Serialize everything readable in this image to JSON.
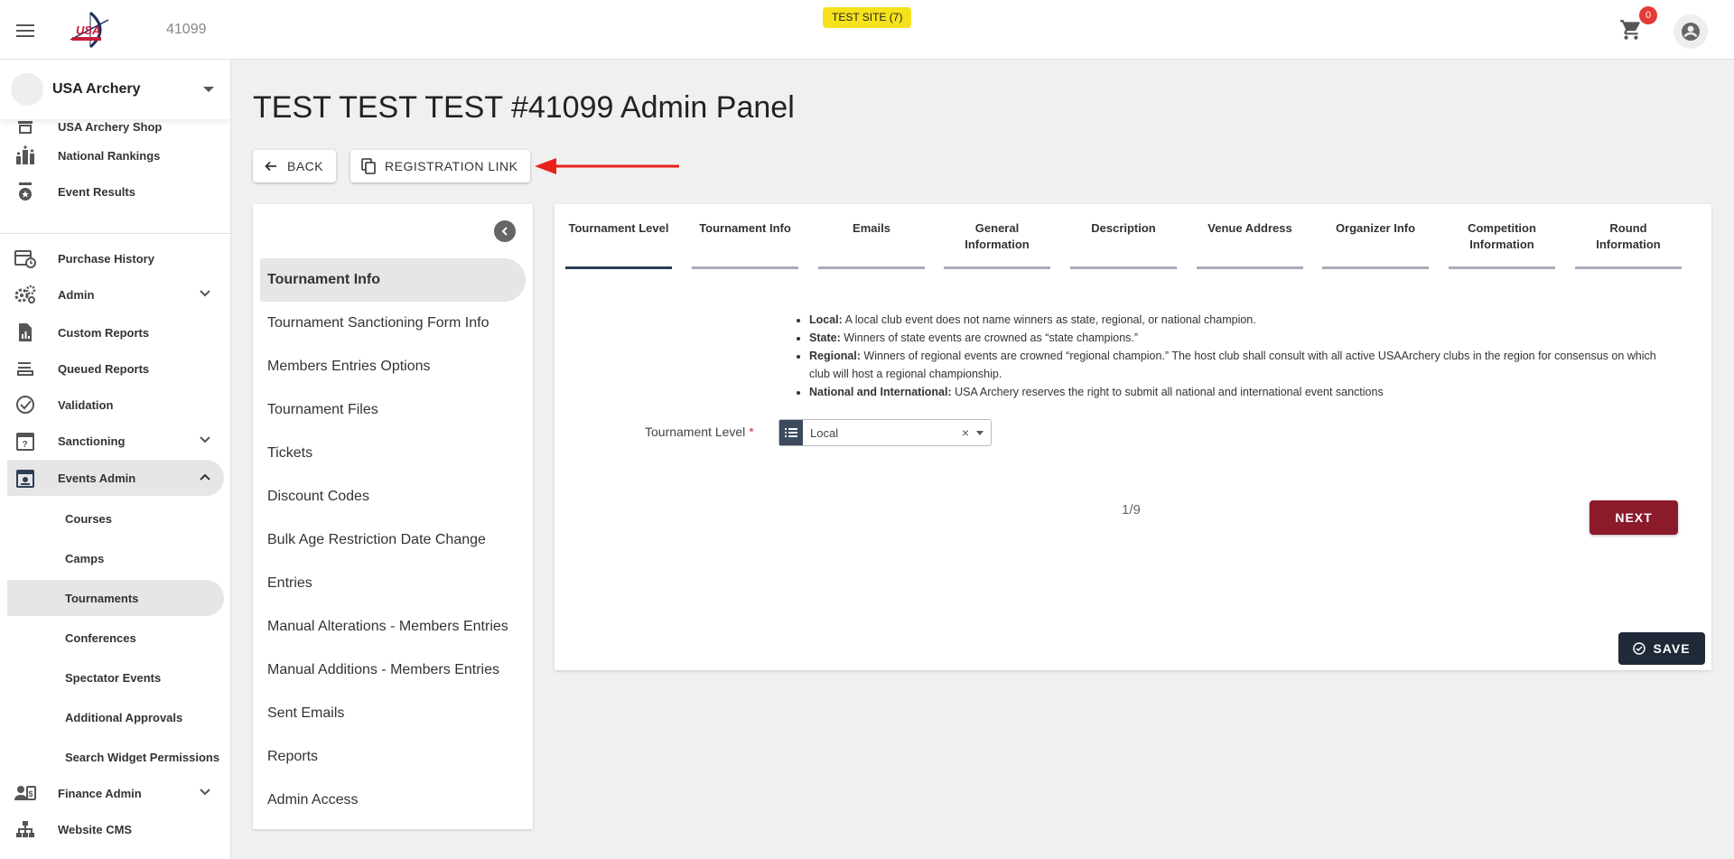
{
  "header": {
    "event_id": "41099",
    "test_badge": "TEST SITE (7)",
    "cart_count": "0"
  },
  "sidebar": {
    "org_name": "USA Archery",
    "partial_item": "USA Archery Shop",
    "items": [
      {
        "label": "National Rankings",
        "icon": "bar-chart-icon"
      },
      {
        "label": "Event Results",
        "icon": "medal-icon"
      },
      {
        "label": "Purchase History",
        "icon": "calendar-clock-icon"
      },
      {
        "label": "Admin",
        "icon": "gears-icon"
      },
      {
        "label": "Custom Reports",
        "icon": "report-icon"
      },
      {
        "label": "Queued Reports",
        "icon": "queue-icon"
      },
      {
        "label": "Validation",
        "icon": "check-circle-icon"
      },
      {
        "label": "Sanctioning",
        "icon": "calendar-question-icon"
      },
      {
        "label": "Events Admin",
        "icon": "event-icon"
      }
    ],
    "sub_items": [
      "Courses",
      "Camps",
      "Tournaments",
      "Conferences",
      "Spectator Events",
      "Additional Approvals",
      "Search Widget Permissions"
    ],
    "bottom_items": [
      {
        "label": "Finance Admin",
        "icon": "finance-icon"
      },
      {
        "label": "Website CMS",
        "icon": "sitemap-icon"
      }
    ]
  },
  "main": {
    "title": "TEST TEST TEST #41099 Admin Panel",
    "back_label": "BACK",
    "registration_link_label": "REGISTRATION LINK"
  },
  "left_menu": [
    "Tournament Info",
    "Tournament Sanctioning Form Info",
    "Members Entries Options",
    "Tournament Files",
    "Tickets",
    "Discount Codes",
    "Bulk Age Restriction Date Change",
    "Entries",
    "Manual Alterations - Members Entries",
    "Manual Additions - Members Entries",
    "Sent Emails",
    "Reports",
    "Admin Access"
  ],
  "steps": [
    {
      "line1": "Tournament Level",
      "line2": ""
    },
    {
      "line1": "Tournament Info",
      "line2": ""
    },
    {
      "line1": "Emails",
      "line2": ""
    },
    {
      "line1": "General",
      "line2": "Information"
    },
    {
      "line1": "Description",
      "line2": ""
    },
    {
      "line1": "Venue Address",
      "line2": ""
    },
    {
      "line1": "Organizer Info",
      "line2": ""
    },
    {
      "line1": "Competition",
      "line2": "Information"
    },
    {
      "line1": "Round",
      "line2": "Information"
    }
  ],
  "info": [
    {
      "term": "Local:",
      "text": " A local club event does not name winners as state, regional, or national champion."
    },
    {
      "term": "State:",
      "text": " Winners of state events are crowned as “state champions.”"
    },
    {
      "term": "Regional:",
      "text": " Winners of regional events are crowned “regional champion.” The host club shall consult with all active USAArchery clubs in the region for consensus on which club will host a regional championship."
    },
    {
      "term": "National and International:",
      "text": " USA Archery reserves the right to submit all national and international event sanctions"
    }
  ],
  "form": {
    "field_label": "Tournament Level",
    "required_mark": "*",
    "selected_value": "Local",
    "clear_glyph": "×"
  },
  "pager": "1/9",
  "next_label": "NEXT",
  "save_label": "SAVE",
  "colors": {
    "next": "#8b1a2b",
    "save": "#1f2937",
    "badge": "#f5e21c",
    "arrow": "#e8221a"
  }
}
